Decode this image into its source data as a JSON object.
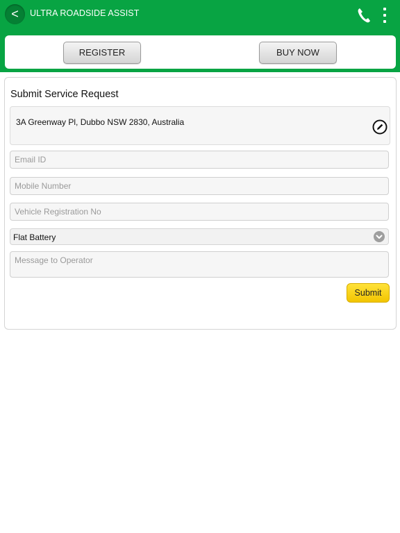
{
  "header": {
    "back_label": "<",
    "title": "ULTRA ROADSIDE ASSIST",
    "phone_icon": "phone-icon",
    "menu_icon": "vertical-dots-icon",
    "bg_color": "#08a443"
  },
  "actions": {
    "register_label": "REGISTER",
    "buy_now_label": "BUY NOW"
  },
  "form": {
    "title": "Submit Service Request",
    "address": "3A Greenway Pl, Dubbo NSW 2830, Australia",
    "email_placeholder": "Email ID",
    "mobile_placeholder": "Mobile Number",
    "vehicle_placeholder": "Vehicle Registration No",
    "service_type_selected": "Flat Battery",
    "message_placeholder": "Message to Operator",
    "submit_label": "Submit",
    "submit_color": "#ffd500"
  }
}
